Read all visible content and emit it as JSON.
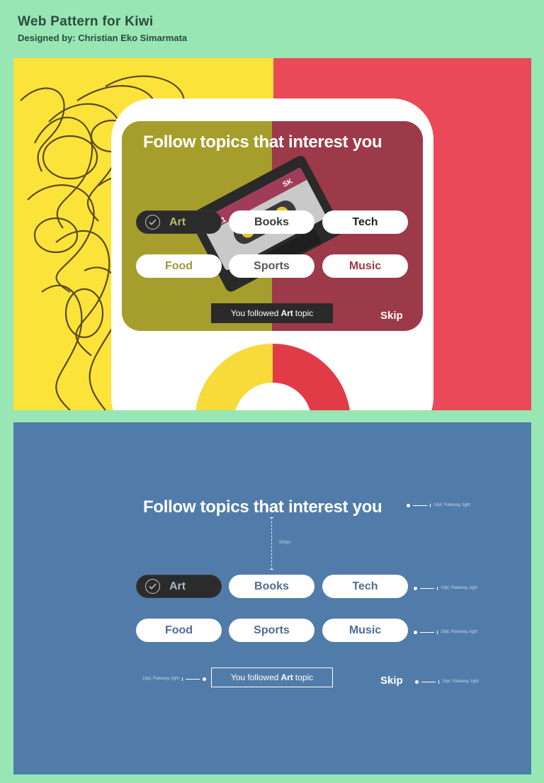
{
  "header": {
    "title": "Web Pattern for Kiwi",
    "subtitle": "Designed by: Christian Eko Simarmata"
  },
  "topics": {
    "headline": "Follow topics that interest you",
    "items": [
      {
        "label": "Art",
        "selected": true
      },
      {
        "label": "Books",
        "selected": false
      },
      {
        "label": "Tech",
        "selected": false
      },
      {
        "label": "Food",
        "selected": false
      },
      {
        "label": "Sports",
        "selected": false
      },
      {
        "label": "Music",
        "selected": false
      }
    ],
    "toast": {
      "prefix": "You followed",
      "bold": "Art",
      "suffix": "topic"
    },
    "skip": "Skip"
  },
  "cassette": {
    "label": "06X1",
    "brand": "SK"
  },
  "specs": {
    "headline_spec": "16pt, Raleway, light",
    "spacing_spec": "500px",
    "row1_spec": "16pt, Raleway, light",
    "row2_spec": "16pt, Raleway, light",
    "toast_spec": "16pt, Raleway, light",
    "skip_spec": "16pt, Raleway, light"
  },
  "colors": {
    "background": "#97e6b4",
    "yellow": "#fbe33a",
    "red": "#ea4a57",
    "blueprint": "#517caa",
    "selected_pill": "#2b2b2b"
  }
}
